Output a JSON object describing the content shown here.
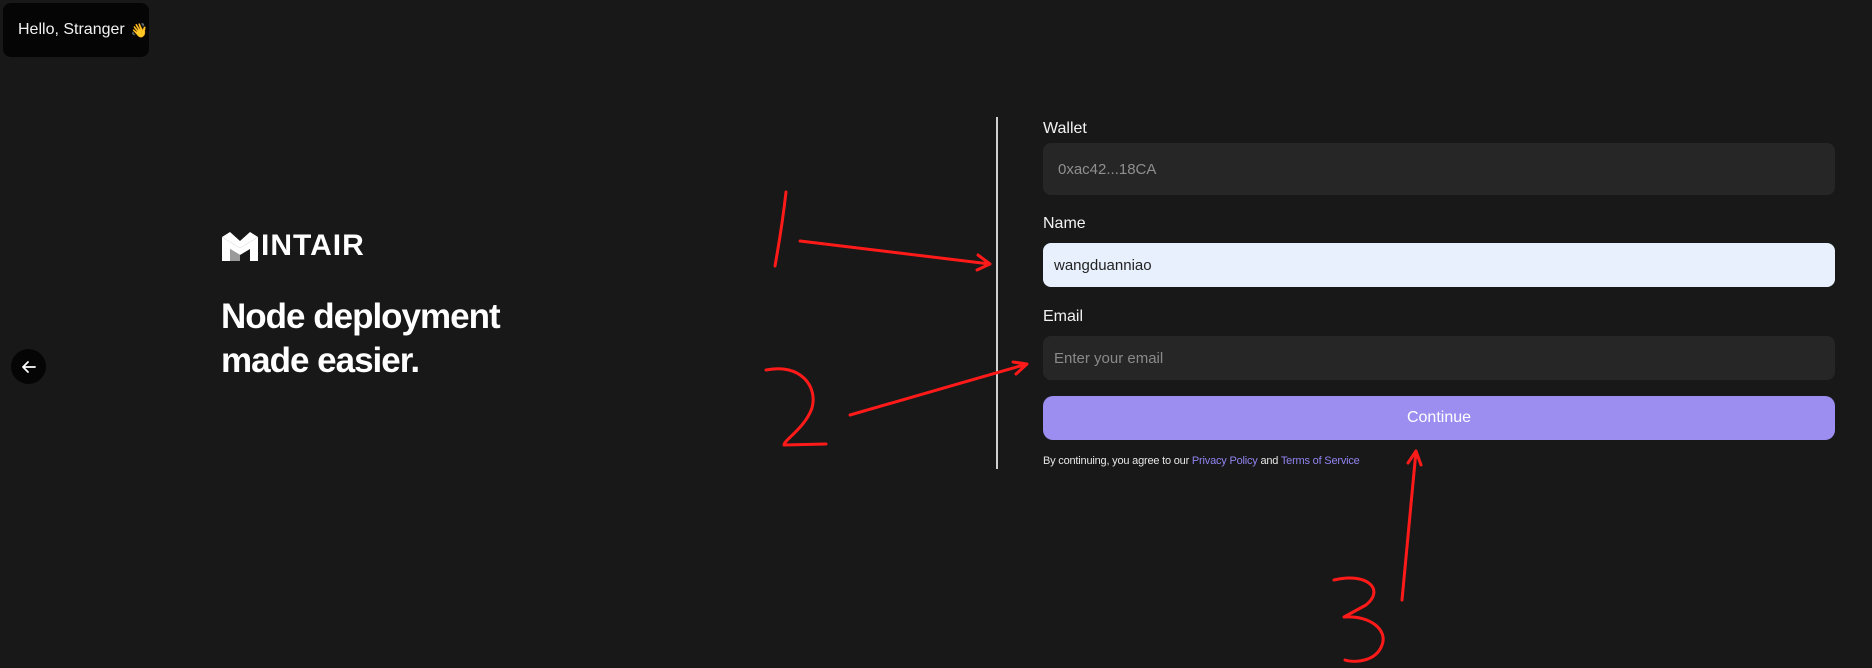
{
  "greeting": {
    "text": "Hello, Stranger",
    "emoji": "👋"
  },
  "back_button": {
    "icon": "arrow-left-icon"
  },
  "brand": {
    "name": "INTAIR",
    "logo_icon": "m-logo-icon"
  },
  "hero": {
    "line1": "Node deployment",
    "line2": "made easier."
  },
  "form": {
    "wallet_label": "Wallet",
    "wallet_value": "0xac42...18CA",
    "name_label": "Name",
    "name_value": "wangduanniao",
    "email_label": "Email",
    "email_placeholder": "Enter your email",
    "continue_label": "Continue",
    "terms_prefix": "By continuing, you agree to our ",
    "privacy_link": "Privacy Policy",
    "terms_and": " and ",
    "tos_link": "Terms of Service"
  },
  "annotations": {
    "marks": [
      "1",
      "2",
      "3"
    ],
    "color": "#ff1a1a"
  },
  "colors": {
    "background": "#181818",
    "accent": "#9b8ef0",
    "autofill": "#e8f0fe"
  }
}
